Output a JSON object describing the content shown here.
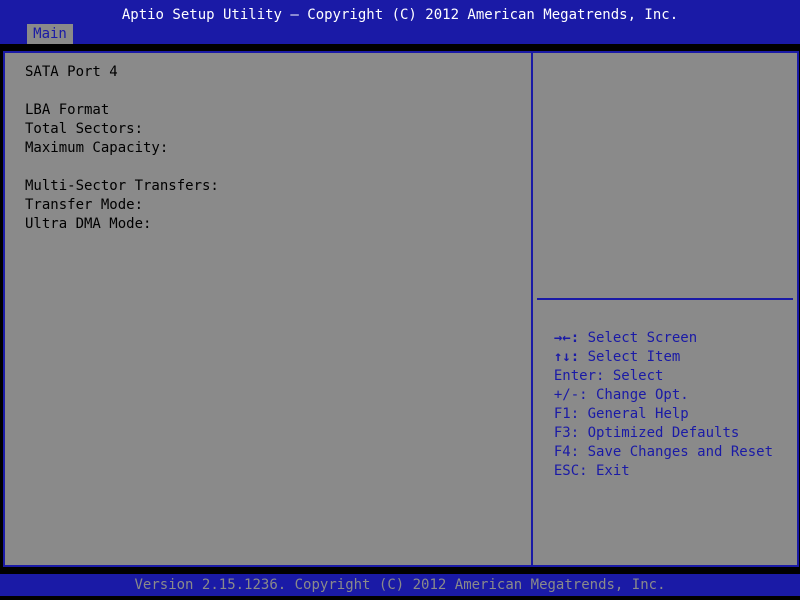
{
  "header": {
    "title": "Aptio Setup Utility – Copyright (C) 2012 American Megatrends, Inc."
  },
  "tabs": [
    {
      "label": "Main"
    }
  ],
  "main": {
    "title": "SATA Port 4",
    "lines": [
      "LBA Format",
      "Total Sectors:",
      "Maximum Capacity:",
      "Multi-Sector Transfers:",
      "Transfer Mode:",
      "Ultra DMA Mode:"
    ]
  },
  "help": {
    "items": [
      {
        "key": "→←:",
        "action": " Select Screen",
        "key_icon": "left-right-arrows-icon"
      },
      {
        "key": "↑↓:",
        "action": " Select Item",
        "key_icon": "up-down-arrows-icon"
      },
      {
        "key": "Enter:",
        "action": " Select"
      },
      {
        "key": "+/-:",
        "action": " Change Opt."
      },
      {
        "key": "F1:",
        "action": " General Help"
      },
      {
        "key": "F3:",
        "action": " Optimized Defaults"
      },
      {
        "key": "F4:",
        "action": " Save Changes and Reset"
      },
      {
        "key": "ESC:",
        "action": " Exit"
      }
    ]
  },
  "footer": {
    "text": "Version 2.15.1236. Copyright (C) 2012 American Megatrends, Inc."
  },
  "colors": {
    "header_blue": "#1a1aa6",
    "panel_gray": "#8a8a8a",
    "text_black": "#000000",
    "text_white": "#ffffff"
  }
}
